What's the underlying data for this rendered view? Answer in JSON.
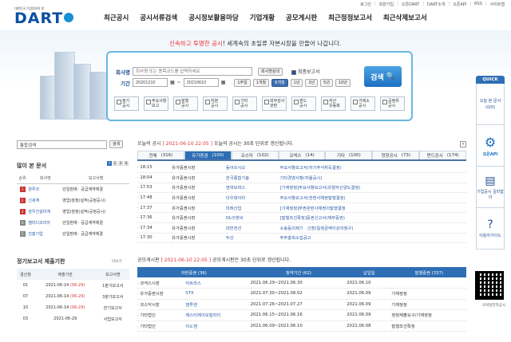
{
  "top_links": [
    "로그인",
    "회원가입",
    "오픈DART",
    "DART소개",
    "오픈API",
    "RSS",
    "사이트맵"
  ],
  "logo": {
    "sub": "대한민국 기업정보의 창",
    "main": "DART"
  },
  "gnb": [
    "최근공시",
    "공시서류검색",
    "공시정보활용마당",
    "기업개황",
    "공모게시판",
    "최근정정보고서",
    "최근삭제보고서"
  ],
  "hero": {
    "pre": "",
    "red": "신속하고 투명한 공시",
    "post": "! 세계속의 초일류 자본시장을 만들어 나갑니다."
  },
  "search": {
    "company_label": "회사명",
    "company_placeholder": "회사명 또는 종목코드를 입력하세요",
    "company_btn": "회사명검색",
    "final_label": "최종보고서",
    "period_label": "기간",
    "date_from": "20201210",
    "date_to": "20210610",
    "period_btns": [
      "1주일",
      "1개월",
      "6개월",
      "1년",
      "3년",
      "5년",
      "10년"
    ],
    "period_active": 2,
    "search_btn": "검색",
    "categories": [
      "정기\n공시",
      "주요사항\n보고",
      "발행\n공시",
      "지분\n공시",
      "기타\n공시",
      "외부감사\n관련",
      "펀드\n공시",
      "자산\n유동화",
      "거래소\n공시",
      "공정위\n공시"
    ]
  },
  "quick": {
    "title": "QUICK",
    "items": [
      {
        "label": "오늘 본 문서",
        "sub": "(0/0)"
      },
      {
        "label": "오픈API"
      },
      {
        "label": "기업공시\n길라잡이"
      },
      {
        "label": "이용자가이드"
      }
    ]
  },
  "mini_search": {
    "placeholder": "통합검색",
    "btn": "검색"
  },
  "popular": {
    "title": "많이 본 문서",
    "pages": [
      "1",
      "2",
      "3",
      "4"
    ],
    "headers": [
      "순위",
      "회사명",
      "보고서명"
    ],
    "rows": [
      [
        "1",
        "양루코",
        "단일판매ㆍ공급계약체결"
      ],
      [
        "2",
        "신세계",
        "영업(잠정)실적(공정공시)"
      ],
      [
        "3",
        "삼우건설미계",
        "영업(잠정)실적(공정공시)"
      ],
      [
        "4",
        "멜마디코리아",
        "단일판매ㆍ공급계약체결"
      ],
      [
        "5",
        "진흥기업",
        "단일판매ㆍ공급계약체결"
      ]
    ]
  },
  "period": {
    "title": "정기보고서 제출기한",
    "more": "더보기",
    "headers": [
      "결산월",
      "제출기한",
      "보고서명"
    ],
    "rows": [
      [
        "01",
        "2021-06-14",
        "(06-29)",
        "1분기보고서"
      ],
      [
        "07",
        "2021-06-14",
        "(06-29)",
        "3분기보고서"
      ],
      [
        "10",
        "2021-06-14",
        "(06-29)",
        "반기보고서"
      ],
      [
        "03",
        "2021-06-29",
        "",
        "사업보고서"
      ]
    ]
  },
  "today": {
    "pre": "오늘의 공시",
    "time": "[ 2021-06-10 22:05 ]",
    "post": "오늘의 공시는 30초 단위로 갱신됩니다.",
    "tabs": [
      [
        "전체",
        "316"
      ],
      [
        "유가증권",
        "100"
      ],
      [
        "코스닥",
        "102"
      ],
      [
        "코넥스",
        "14"
      ],
      [
        "기타",
        "100"
      ],
      [
        "정정공시",
        "73"
      ],
      [
        "펀드공시",
        "174"
      ]
    ],
    "rows": [
      [
        "18:15",
        "유가증권시장",
        "동아쏘시오",
        "주요사항보고서(자기주식취득결정)"
      ],
      [
        "18:04",
        "유가증권시장",
        "한국종합기술",
        "기타경영사항(자율공시)"
      ],
      [
        "17:53",
        "유가증권시장",
        "현대모비스",
        "[기재정정]주요사항보고서(유형자산양도결정)"
      ],
      [
        "17:48",
        "유가증권시장",
        "다우데이타",
        "주요사항보고서(전환사채권발행결정)"
      ],
      [
        "17:37",
        "유가증권시장",
        "미래산업",
        "[기재정정]주권관련사채권의발행결정"
      ],
      [
        "17:36",
        "유가증권시장",
        "DL이앤씨",
        "[발행조건확정]증권신고서(채무증권)"
      ],
      [
        "17:34",
        "유가증권시장",
        "대한전선",
        "소송등의제기ㆍ신청(일정금액이상의청구)"
      ],
      [
        "17:30",
        "유가증권시장",
        "두산",
        "주주총회소집공고"
      ]
    ]
  },
  "disclosure": {
    "pre": "공모게시판",
    "time": "[ 2021-06-10 22:05 ]",
    "post": "공모게시판은 30초 단위로 갱신됩니다.",
    "headers": [
      [
        "자본증권",
        "36"
      ],
      [
        "청약기간",
        "62"
      ],
      [
        "납입일",
        ""
      ],
      [
        "발행증권",
        "337"
      ]
    ],
    "rows": [
      [
        "코넥스시장",
        "아트라스",
        "2021.06.29~2021.06.30",
        "2021.06.10",
        ""
      ],
      [
        "유가증권시장",
        "STX",
        "2021.07.30~2021.08.02",
        "2021.06.09",
        "기재정정"
      ],
      [
        "코스닥시장",
        "엠투엔",
        "2021.07.26~2021.07.27",
        "2021.06.09",
        "기재정정"
      ],
      [
        "기타법인",
        "에스티에이모빌리티",
        "2021.06.15~2021.06.16",
        "2021.06.09",
        "정정제출요구/기재정정"
      ],
      [
        "기타법인",
        "이노엠",
        "2021.06.09~2021.06.10",
        "2021.06.08",
        "발행조건확정"
      ]
    ]
  },
  "qr_label": "모바일전자공시"
}
